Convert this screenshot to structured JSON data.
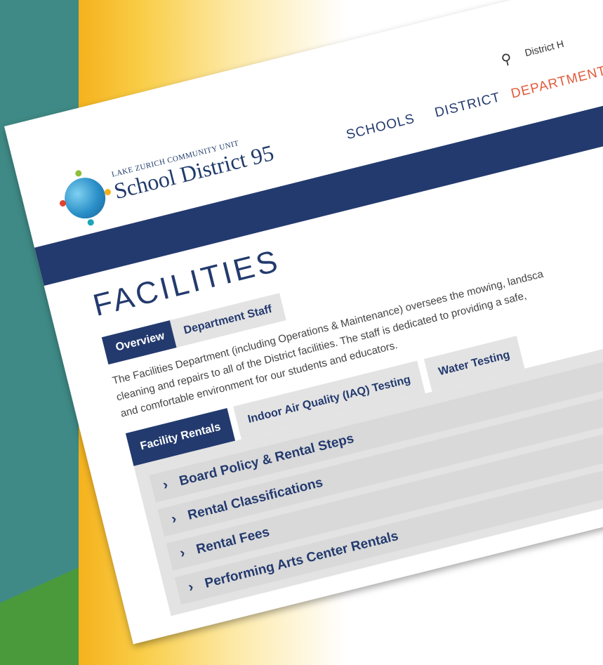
{
  "utility": {
    "search_icon": "search-icon",
    "link_fragment": "District H"
  },
  "logo": {
    "small_text": "LAKE ZURICH COMMUNITY UNIT",
    "big_text": "School District 95"
  },
  "nav": {
    "items": [
      "SCHOOLS",
      "DISTRICT",
      "DEPARTMENTS"
    ],
    "active": "DEPARTMENTS"
  },
  "page": {
    "title": "FACILITIES"
  },
  "tabs": [
    {
      "label": "Overview",
      "active": true
    },
    {
      "label": "Department Staff",
      "active": false
    }
  ],
  "intro": {
    "line1": "The Facilities Department (including Operations & Maintenance) oversees the mowing, landsca",
    "line2": "cleaning and repairs to all of the District facilities.  The staff is dedicated to providing a safe,",
    "line3": "and comfortable environment for our students and educators."
  },
  "subtabs": [
    {
      "label": "Facility Rentals",
      "active": true
    },
    {
      "label": "Indoor Air Quality (IAQ) Testing",
      "active": false
    },
    {
      "label": "Water Testing",
      "active": false
    }
  ],
  "accordion": [
    {
      "label": "Board Policy & Rental Steps"
    },
    {
      "label": "Rental Classifications"
    },
    {
      "label": "Rental Fees"
    },
    {
      "label": "Performing Arts Center Rentals"
    }
  ],
  "colors": {
    "navy": "#233a6e",
    "accent": "#e25b3b",
    "teal": "#3f8a86",
    "gold": "#f5b21d",
    "green": "#4a9a3c"
  }
}
